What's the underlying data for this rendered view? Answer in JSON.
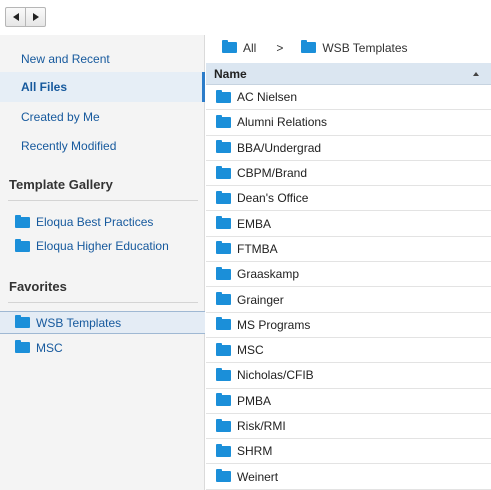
{
  "toolbar": {
    "back_icon": "triangle-left-icon",
    "forward_icon": "triangle-right-icon"
  },
  "sidebar": {
    "nav_items": [
      {
        "label": "New and Recent"
      },
      {
        "label": "All Files",
        "selected": true
      },
      {
        "label": "Created by Me"
      },
      {
        "label": "Recently Modified"
      }
    ],
    "template_gallery": {
      "title": "Template Gallery",
      "items": [
        {
          "label": "Eloqua Best Practices"
        },
        {
          "label": "Eloqua Higher Education"
        }
      ]
    },
    "favorites": {
      "title": "Favorites",
      "items": [
        {
          "label": "WSB Templates",
          "selected": true
        },
        {
          "label": "MSC"
        }
      ]
    }
  },
  "main": {
    "breadcrumb": {
      "root": "All",
      "separator": ">",
      "current": "WSB Templates"
    },
    "column_header": "Name",
    "folders": [
      "AC Nielsen",
      "Alumni Relations",
      "BBA/Undergrad",
      "CBPM/Brand",
      "Dean's Office",
      "EMBA",
      "FTMBA",
      "Graaskamp",
      "Grainger",
      "MS Programs",
      "MSC",
      "Nicholas/CFIB",
      "PMBA",
      "Risk/RMI",
      "SHRM",
      "Weinert"
    ]
  },
  "colors": {
    "link": "#16599d",
    "folder": "#1b8fd9",
    "header_bg": "#dbe6f1",
    "sidebar_bg": "#f4f4f4"
  }
}
